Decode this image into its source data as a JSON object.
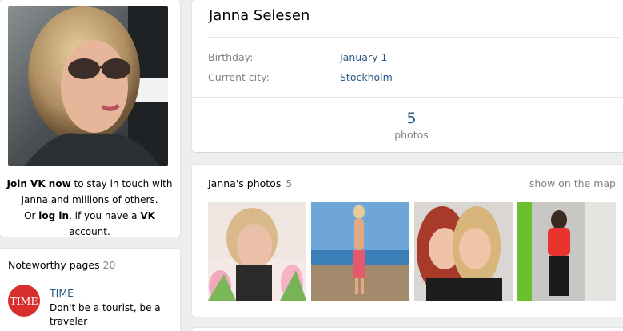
{
  "sidebar": {
    "join": {
      "bold1": "Join VK now",
      "text1": " to stay in touch with Janna and millions of others.",
      "text2": "Or ",
      "login": "log in",
      "text3": ", if you have a ",
      "vk": "VK",
      "text4": " account."
    },
    "noteworthy": {
      "title": "Noteworthy pages",
      "count": "20",
      "items": [
        {
          "logo": "TIME",
          "name": "TIME",
          "desc": "Don't be a tourist, be a traveler"
        }
      ]
    }
  },
  "profile": {
    "name": "Janna Selesen",
    "fields": [
      {
        "label": "Birthday:",
        "value": "January 1"
      },
      {
        "label": "Current city:",
        "value": "Stockholm"
      }
    ],
    "counter": {
      "number": "5",
      "label": "photos"
    }
  },
  "photos": {
    "title": "Janna's photos",
    "count": "5",
    "map_link": "show on the map"
  },
  "colors": {
    "link": "#2a5885",
    "muted": "#828282",
    "time_red": "#d92e2e"
  }
}
